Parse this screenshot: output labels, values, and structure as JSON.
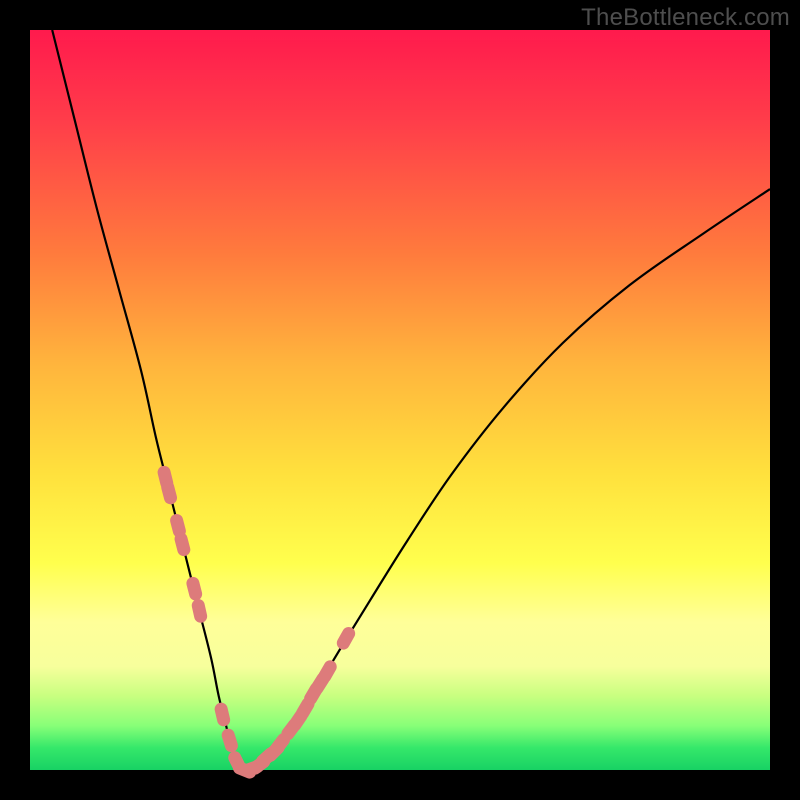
{
  "watermark": "TheBottleneck.com",
  "colors": {
    "frame": "#000000",
    "curve": "#000000",
    "marker": "#dd7b7b",
    "gradient_top": "#ff1a4d",
    "gradient_bottom": "#18d264"
  },
  "chart_data": {
    "type": "line",
    "title": "",
    "xlabel": "",
    "ylabel": "",
    "xlim": [
      0,
      100
    ],
    "ylim": [
      0,
      100
    ],
    "x": [
      3,
      6,
      9,
      12,
      15,
      17,
      18.5,
      20,
      21.5,
      23,
      24.5,
      25.5,
      26.5,
      27.2,
      28,
      29,
      30,
      31.5,
      33,
      35,
      37,
      39,
      42,
      46,
      51,
      57,
      64,
      72,
      81,
      91,
      100
    ],
    "values": [
      100,
      88,
      76,
      65,
      54,
      45,
      39,
      33,
      27,
      21,
      15,
      10,
      6,
      3,
      1,
      0,
      0.2,
      1,
      2.5,
      5,
      8,
      11.5,
      16.5,
      23,
      31,
      40,
      49,
      57.7,
      65.5,
      72.5,
      78.5
    ],
    "markers": {
      "x": [
        18.3,
        18.8,
        20.0,
        20.6,
        22.2,
        22.9,
        26.0,
        27.0,
        28.0,
        29.0,
        30.0,
        31.0,
        32.0,
        33.0,
        33.8,
        35.3,
        36.2,
        37.2,
        38.3,
        39.2,
        40.2,
        42.7
      ],
      "y": [
        39.5,
        37.5,
        33.0,
        30.5,
        24.5,
        21.5,
        7.5,
        4.0,
        1.0,
        0.0,
        0.2,
        0.7,
        1.7,
        2.5,
        3.5,
        5.5,
        6.7,
        8.3,
        10.3,
        11.7,
        13.3,
        17.8
      ]
    }
  }
}
